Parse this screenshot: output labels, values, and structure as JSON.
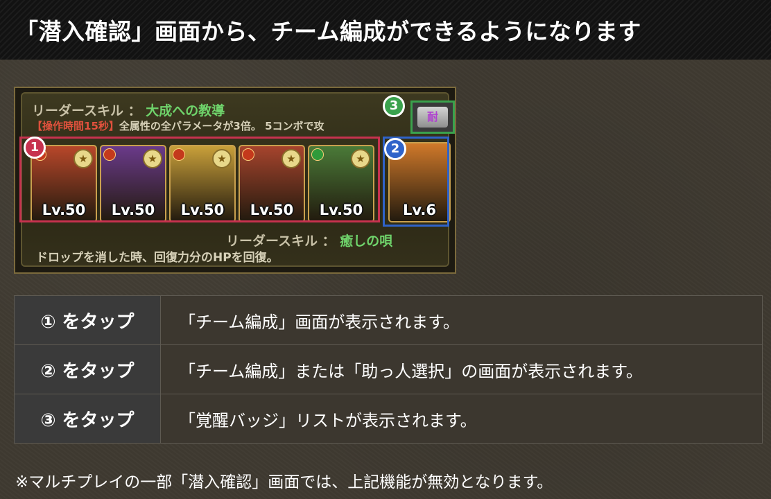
{
  "header": {
    "title": "「潜入確認」画面から、チーム編成ができるようになります"
  },
  "screenshot": {
    "leader_skill_label": "リーダースキル ：",
    "leader_skill_name": "大成への教導",
    "leader_skill_desc_tag": "【操作時間15秒】",
    "leader_skill_desc": "全属性の全パラメータが3倍。 5コンボで攻",
    "team": [
      {
        "level": "Lv.50",
        "color": "#b8472a"
      },
      {
        "level": "Lv.50",
        "color": "#6a3a8a"
      },
      {
        "level": "Lv.50",
        "color": "#c9a03a"
      },
      {
        "level": "Lv.50",
        "color": "#a6442d"
      },
      {
        "level": "Lv.50",
        "color": "#4a7a38"
      }
    ],
    "helper": {
      "level": "Lv.6",
      "color": "#d0792a"
    },
    "helper_skill_label": "リーダースキル ：",
    "helper_skill_name": "癒しの唄",
    "helper_skill_desc": "ドロップを消した時、回復力分のHPを回復。",
    "badge_button_label": "耐",
    "markers": {
      "one": "1",
      "two": "2",
      "three": "3"
    },
    "marker_colors": {
      "one": "#c7324f",
      "two": "#2f63c9",
      "three": "#3aa24d"
    }
  },
  "instructions": [
    {
      "key": "① をタップ",
      "desc": "「チーム編成」画面が表示されます。"
    },
    {
      "key": "② をタップ",
      "desc": "「チーム編成」または「助っ人選択」の画面が表示されます。"
    },
    {
      "key": "③ をタップ",
      "desc": "「覚醒バッジ」リストが表示されます。"
    }
  ],
  "note": "※マルチプレイの一部「潜入確認」画面では、上記機能が無効となります。"
}
